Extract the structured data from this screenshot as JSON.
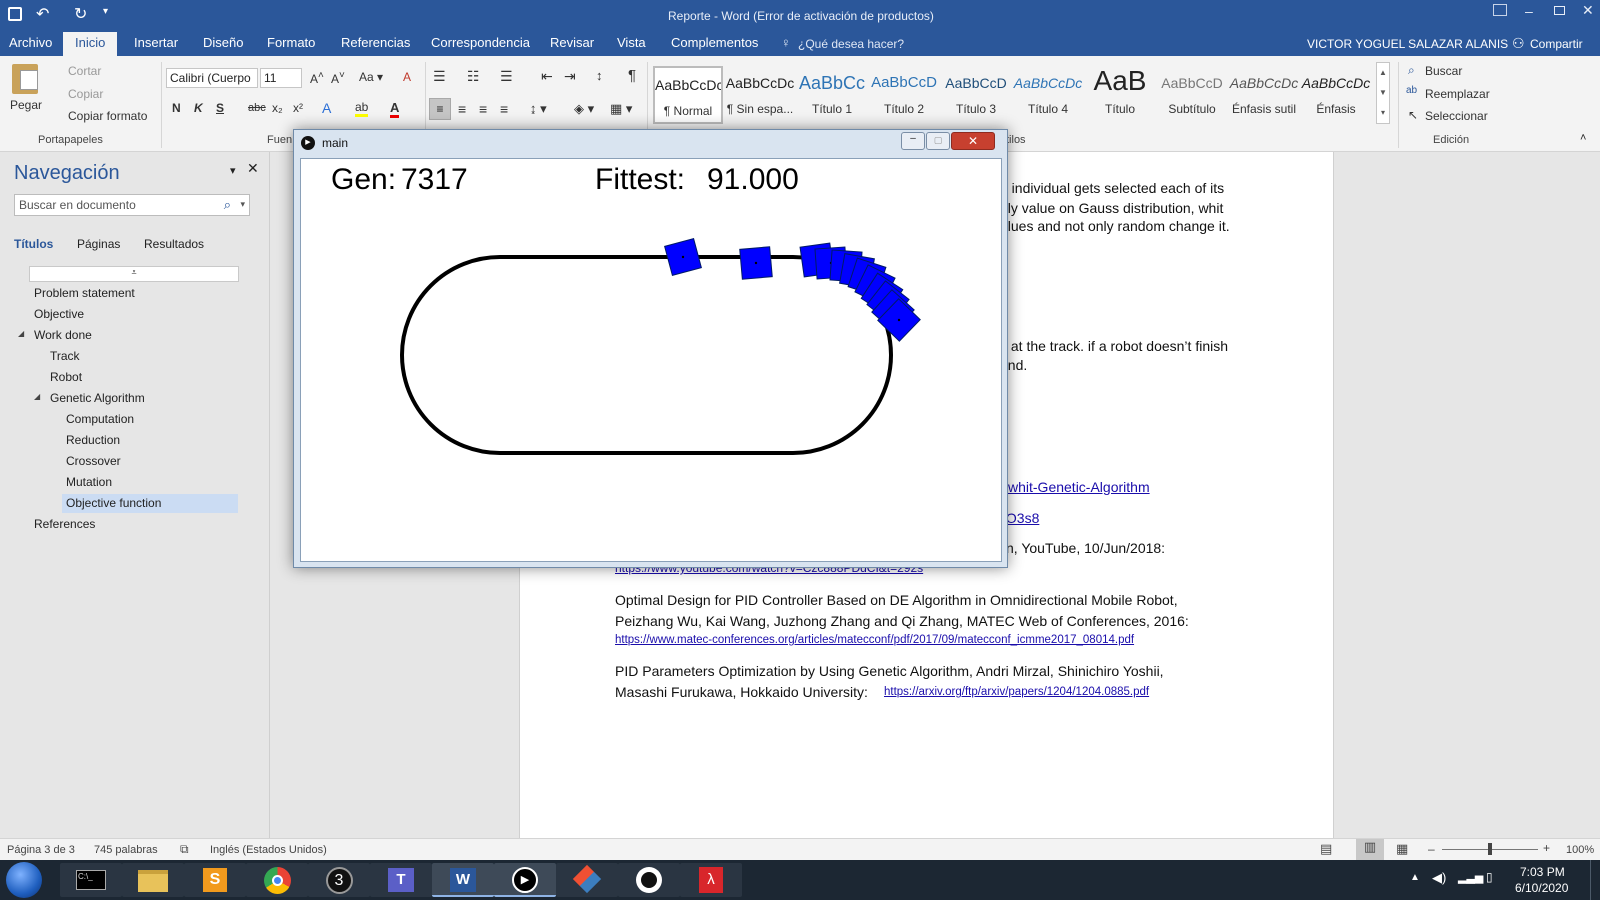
{
  "word": {
    "title": "Reporte - Word (Error de activación de productos)",
    "user": "VICTOR YOGUEL SALAZAR ALANIS",
    "share": "Compartir",
    "tell_me": "¿Qué desea hacer?",
    "tabs": [
      "Archivo",
      "Inicio",
      "Insertar",
      "Diseño",
      "Formato",
      "Referencias",
      "Correspondencia",
      "Revisar",
      "Vista",
      "Complementos"
    ],
    "clipboard": {
      "paste": "Pegar",
      "cut": "Cortar",
      "copy": "Copiar",
      "format_painter": "Copiar formato",
      "group": "Portapapeles"
    },
    "font": {
      "name": "Calibri (Cuerpo",
      "size": "11",
      "group": "Fuen"
    },
    "styles": {
      "group": "tilos",
      "items": [
        {
          "preview": "AaBbCcDc",
          "name": "¶ Normal"
        },
        {
          "preview": "AaBbCcDc",
          "name": "¶ Sin espa..."
        },
        {
          "preview": "AaBbCc",
          "name": "Título 1"
        },
        {
          "preview": "AaBbCcD",
          "name": "Título 2"
        },
        {
          "preview": "AaBbCcD",
          "name": "Título 3"
        },
        {
          "preview": "AaBbCcDc",
          "name": "Título 4"
        },
        {
          "preview": "AaB",
          "name": "Título"
        },
        {
          "preview": "AaBbCcD",
          "name": "Subtítulo"
        },
        {
          "preview": "AaBbCcDc",
          "name": "Énfasis sutil"
        },
        {
          "preview": "AaBbCcDc",
          "name": "Énfasis"
        }
      ]
    },
    "editing": {
      "find": "Buscar",
      "replace": "Reemplazar",
      "select": "Seleccionar",
      "group": "Edición"
    }
  },
  "nav": {
    "title": "Navegación",
    "search_placeholder": "Buscar en documento",
    "tabs": [
      "Títulos",
      "Páginas",
      "Resultados"
    ],
    "headings": [
      {
        "label": "Problem statement",
        "level": 1
      },
      {
        "label": "Objective",
        "level": 1
      },
      {
        "label": "Work done",
        "level": 1
      },
      {
        "label": "Track",
        "level": 2
      },
      {
        "label": "Robot",
        "level": 2
      },
      {
        "label": "Genetic Algorithm",
        "level": 2
      },
      {
        "label": "Computation",
        "level": 3
      },
      {
        "label": "Reduction",
        "level": 3
      },
      {
        "label": "Crossover",
        "level": 3
      },
      {
        "label": "Mutation",
        "level": 3
      },
      {
        "label": "Objective function",
        "level": 3,
        "selected": true
      },
      {
        "label": "References",
        "level": 1
      }
    ]
  },
  "doc": {
    "frag1": "n individual gets selected each of its",
    "frag2": "nly value on Gauss distribution, whit",
    "frag3": "alues and not only random change it.",
    "frag4": "s at the track. if a robot doesn’t finish",
    "frag5": "end.",
    "link1": "whit-Genetic-Algorithm",
    "link2": ":O3s8",
    "frag6": "n, YouTube, 10/Jun/2018:",
    "link3": "https://www.youtube.com/watch?v=Czc888PDdCI&t=292s",
    "ref2a": "Optimal Design for PID Controller Based on DE Algorithm in Omnidirectional Mobile Robot,",
    "ref2b": "Peizhang Wu, Kai Wang, Juzhong Zhang and Qi Zhang, MATEC Web of Conferences, 2016:",
    "link4": "https://www.matec-conferences.org/articles/matecconf/pdf/2017/09/matecconf_icmme2017_08014.pdf",
    "ref3a": "PID Parameters Optimization by Using Genetic Algorithm, Andri Mirzal, Shinichiro Yoshii,",
    "ref3b": "Masashi Furukawa, Hokkaido University:",
    "link5": "https://arxiv.org/ftp/arxiv/papers/1204/1204.0885.pdf"
  },
  "sim": {
    "window_title": "main",
    "gen_label": "Gen:",
    "gen_value": "7317",
    "fittest_label": "Fittest:",
    "fittest_value": "91.000",
    "robot_color": "#0000ff"
  },
  "status": {
    "page": "Página 3 de 3",
    "words": "745 palabras",
    "language": "Inglés (Estados Unidos)",
    "zoom": "100%"
  },
  "taskbar": {
    "time": "7:03 PM",
    "date": "6/10/2020",
    "apps": [
      "cmd-icon",
      "file-explorer-icon",
      "sublime-icon",
      "chrome-icon",
      "brackets-icon",
      "teams-icon",
      "word-icon",
      "player-icon",
      "git-icon",
      "github-icon",
      "acrobat-icon"
    ]
  }
}
